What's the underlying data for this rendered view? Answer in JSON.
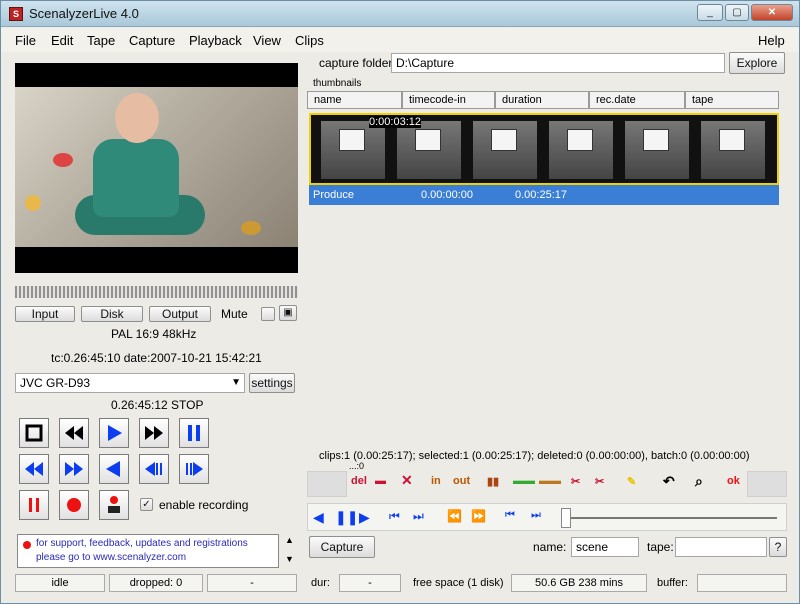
{
  "window": {
    "title": "ScenalyzerLive 4.0"
  },
  "menu": [
    "File",
    "Edit",
    "Tape",
    "Capture",
    "Playback",
    "View",
    "Clips",
    "Help"
  ],
  "left": {
    "tabs": [
      "Input",
      "Disk",
      "Output",
      "Mute"
    ],
    "format": "PAL 16:9 48kHz",
    "timecode_line": "tc:0.26:45:10  date:2007-10-21 15:42:21",
    "device": "JVC GR-D93",
    "settings_label": "settings",
    "status_time": "0.26:45:12 STOP",
    "enable_recording_label": "enable recording",
    "info": "for support, feedback, updates and registrations please go to www.scenalyzer.com"
  },
  "capture": {
    "folder_label": "capture folder",
    "folder_value": "D:\\Capture",
    "explore_label": "Explore",
    "thumbnails_label": "thumbnails"
  },
  "columns": [
    "name",
    "timecode-in",
    "duration",
    "rec.date",
    "tape"
  ],
  "clip": {
    "timecode_overlay": "0:00:03:12",
    "name": "Produce",
    "tc_in": "0.00:00:00",
    "duration": "0.00:25:17"
  },
  "summary": "clips:1 (0.00:25:17); selected:1 (0.00:25:17); deleted:0 (0.00:00:00), batch:0 (0.00:00:00)",
  "summary_sub": "...:0",
  "edit_tools": [
    "del",
    "in",
    "out",
    "ok"
  ],
  "bottom": {
    "capture_button": "Capture",
    "name_label": "name:",
    "name_value": "scene",
    "tape_label": "tape:",
    "help": "?"
  },
  "status": {
    "state": "idle",
    "dropped": "dropped: 0",
    "dash": "-",
    "dur_label": "dur:",
    "dur_value": "-",
    "free_label": "free space (1 disk)",
    "free_value": "50.6 GB 238 mins",
    "buffer_label": "buffer:"
  }
}
